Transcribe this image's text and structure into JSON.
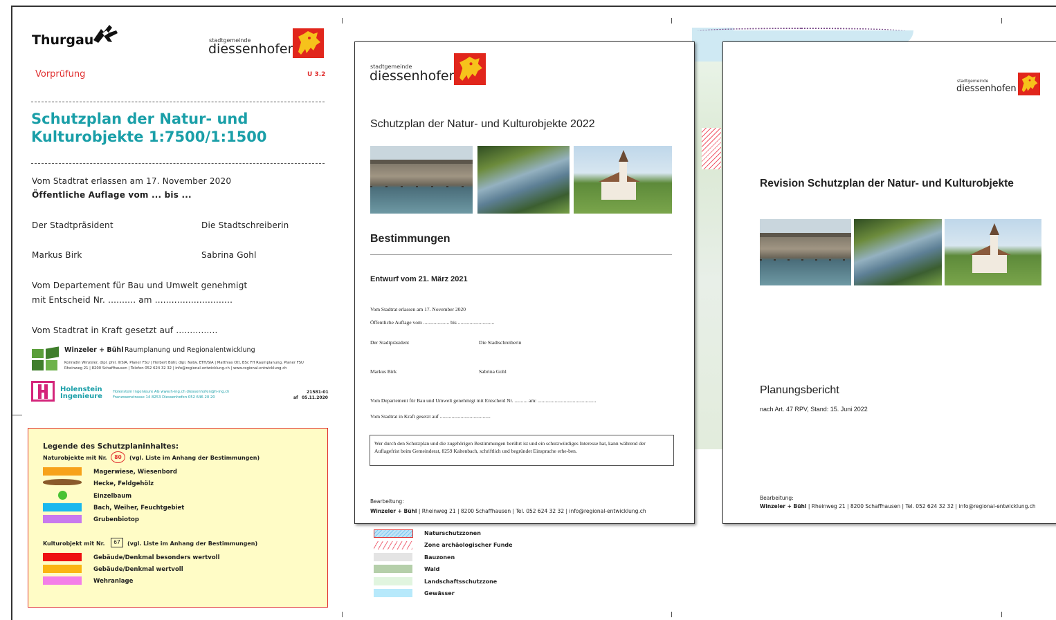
{
  "left_page": {
    "brand": "Thurgau",
    "municipality_small": "stadtgemeinde",
    "municipality": "diessenhofen",
    "status": "Vorprüfung",
    "code": "U 3.2",
    "title_line1": "Schutzplan der Natur- und",
    "title_line2": "Kulturobjekte 1:7500/1:1500",
    "enacted": "Vom Stadtrat erlassen am 17. November 2020",
    "public_display": "Öffentliche Auflage vom ... bis ...",
    "president_label": "Der Stadtpräsident",
    "clerk_label": "Die Stadtschreiberin",
    "president_name": "Markus Birk",
    "clerk_name": "Sabrina Gohl",
    "approved_line1": "Vom Departement für Bau und Umwelt genehmigt",
    "approved_line2": "mit Entscheid Nr. .......... am ............................",
    "in_force": "Vom Stadtrat in Kraft gesetzt auf ...............",
    "firm1_name": "Winzeler + Bühl",
    "firm1_desc": "Raumplanung und Regionalentwicklung",
    "firm1_line1": "Konradin Winzeler, dipl. phil. II/SIA, Planer FSU | Herbert Bühl, dipl. Natw. ETH/SIA | Matthias Ott, BSc FH Raumplanung, Planer FSU",
    "firm1_line2": "Rheinweg 21 | 8200 Schaffhausen | Telefon 052 624 32 32 | info@regional-entwicklung.ch | www.regional-entwicklung.ch",
    "firm2_name1": "Holenstein",
    "firm2_name2": "Ingenieure",
    "firm2_line1": "Holenstein Ingenieure AG www.h-ing.ch diessenhofen@h-ing.ch",
    "firm2_line2": "Franzosenstrasse 14 8253 Diessenhofen 052 646 20 20",
    "doc_no": "21581-01",
    "doc_date_prefix": "af",
    "doc_date": "05.11.2020"
  },
  "legend": {
    "title": "Legende des Schutzplaninhaltes:",
    "nature_head": "Naturobjekte mit Nr.",
    "nature_no": "80",
    "nature_note": "(vgl. Liste im Anhang der Bestimmungen)",
    "nature_items": [
      "Magerwiese, Wiesenbord",
      "Hecke, Feldgehölz",
      "Einzelbaum",
      "Bach, Weiher, Feuchtgebiet",
      "Grubenbiotop"
    ],
    "culture_head": "Kulturobjekt mit Nr.",
    "culture_no": "67",
    "culture_note": "(vgl. Liste im Anhang der Bestimmungen)",
    "culture_items": [
      "Gebäude/Denkmal besonders wertvoll",
      "Gebäude/Denkmal wertvoll",
      "Wehranlage"
    ],
    "colors": {
      "magerwiese": "#f7a21a",
      "hecke": "#8a5a2b",
      "einzelbaum": "#49c233",
      "bach": "#19b8ee",
      "grubenbiotop": "#c879ee",
      "besonders": "#ee1111",
      "wertvoll": "#fbb511",
      "wehranlage": "#f47ee8"
    }
  },
  "bottom_legend": {
    "items": [
      "Naturschutzzonen",
      "Zone archäologischer Funde",
      "Bauzonen",
      "Wald",
      "Landschaftsschutzzone",
      "Gewässer"
    ]
  },
  "middle_page": {
    "municipality_small": "stadtgemeinde",
    "municipality": "diessenhofen",
    "title": "Schutzplan der Natur- und Kulturobjekte 2022",
    "section": "Bestimmungen",
    "draft": "Entwurf vom 21. März 2021",
    "enacted": "Vom Stadtrat erlassen am 17. November 2020",
    "public_display": "Öffentliche Auflage vom .................... bis ............................",
    "president_label": "Der Stadtpräsident",
    "clerk_label": "Die Stadtschreiberin",
    "president_name": "Markus Birk",
    "clerk_name": "Sabrina Gohl",
    "approved": "Vom Departement für Bau und Umwelt genehmigt mit Entscheid Nr. .......... am: .............................................",
    "in_force": "Vom Stadtrat in Kraft gesetzt auf .......................................",
    "notice": "Wer durch den Schutzplan und die zugehörigen Bestimmungen berührt ist und ein schutzwürdiges Interesse hat, kann während der Auflagefrist beim Gemeinderat, 8259 Kaltenbach, schriftlich und begründet Einsprache erhe-ben.",
    "editor_label": "Bearbeitung:",
    "editor_firm": "Winzeler + Bühl",
    "editor_details": " | Rheinweg 21 | 8200 Schaffhausen | Tel. 052 624 32 32 | info@regional-entwicklung.ch"
  },
  "right_page": {
    "municipality_small": "stadtgemeinde",
    "municipality": "diessenhofen",
    "title": "Revision Schutzplan der Natur- und Kulturobjekte",
    "report": "Planungsbericht",
    "report_sub": "nach Art. 47 RPV, Stand: 15. Juni 2022",
    "editor_label": "Bearbeitung:",
    "editor_firm": "Winzeler + Bühl",
    "editor_details": " | Rheinweg 21 | 8200 Schaffhausen | Tel. 052 624 32 32 | info@regional-entwicklung.ch"
  }
}
